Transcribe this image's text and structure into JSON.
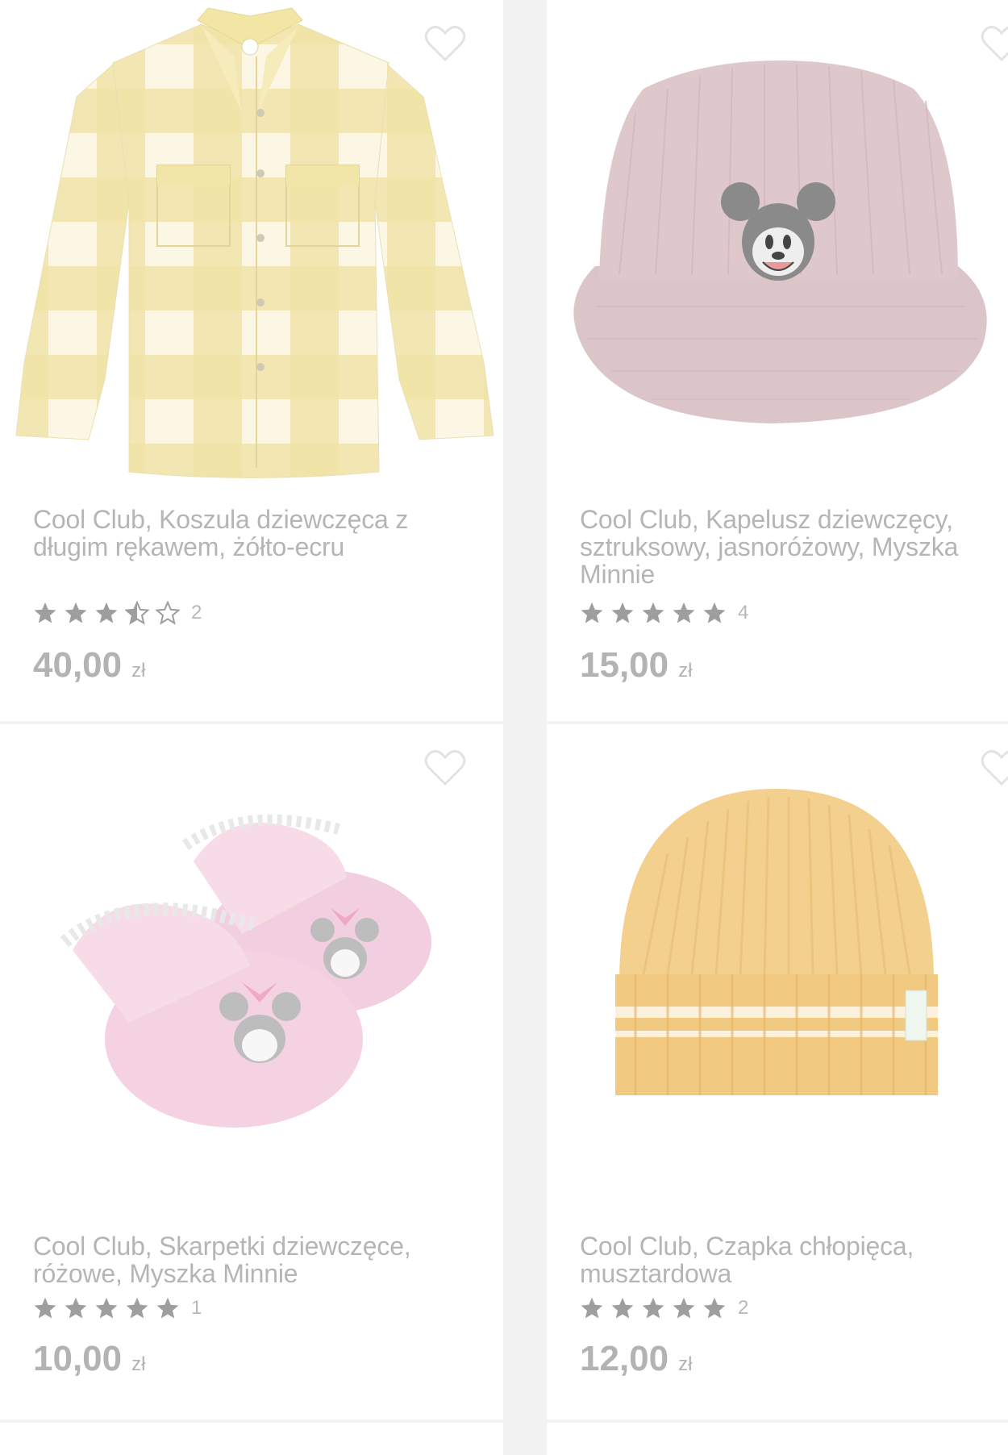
{
  "products": [
    {
      "title": "Cool Club, Koszula dziewczęca z długim rękawem, żółto-ecru",
      "rating": 3.5,
      "reviews": "2",
      "price": "40,00",
      "currency": "zł",
      "image_icon": "plaid-shirt-image"
    },
    {
      "title": "Cool Club, Kapelusz dziewczęcy, sztruksowy, jasnoróżowy, Myszka Minnie",
      "rating": 5,
      "reviews": "4",
      "price": "15,00",
      "currency": "zł",
      "image_icon": "bucket-hat-image"
    },
    {
      "title": "Cool Club, Skarpetki dziewczęce, różowe, Myszka Minnie",
      "rating": 5,
      "reviews": "1",
      "price": "10,00",
      "currency": "zł",
      "image_icon": "baby-socks-image"
    },
    {
      "title": "Cool Club, Czapka chłopięca, musztardowa",
      "rating": 5,
      "reviews": "2",
      "price": "12,00",
      "currency": "zł",
      "image_icon": "beanie-image"
    }
  ],
  "colors": {
    "star": "#9e9e9e",
    "text": "#b5b5b5",
    "card": "#ffffff",
    "background": "#f2f2f2"
  }
}
